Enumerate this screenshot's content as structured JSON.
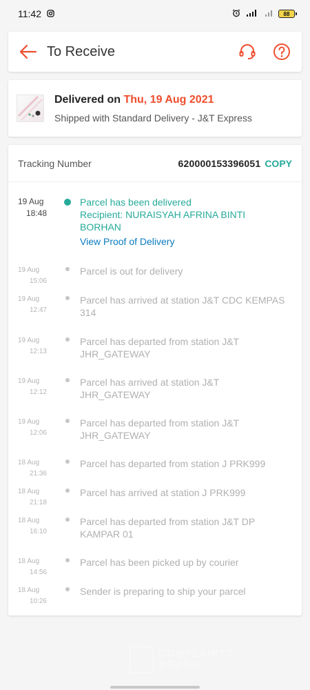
{
  "status_bar": {
    "time": "11:42",
    "battery": "88"
  },
  "header": {
    "title": "To Receive"
  },
  "delivery": {
    "delivered_prefix": "Delivered on",
    "delivered_date": "Thu, 19 Aug 2021",
    "shipped_text": "Shipped with Standard Delivery  - J&T Express"
  },
  "tracking": {
    "label": "Tracking Number",
    "number": "620000153396051",
    "copy_label": "COPY"
  },
  "events": [
    {
      "date": "19 Aug",
      "time": "18:48",
      "text": "Parcel has been delivered",
      "recipient": "Recipient: NURAISYAH AFRINA BINTI BORHAN",
      "link": "View Proof of Delivery"
    },
    {
      "date": "19 Aug",
      "time": "15:06",
      "text": "Parcel is out for delivery"
    },
    {
      "date": "19 Aug",
      "time": "12:47",
      "text": "Parcel has arrived at station J&T CDC KEMPAS 314"
    },
    {
      "date": "19 Aug",
      "time": "12:13",
      "text": "Parcel has departed from station J&T JHR_GATEWAY"
    },
    {
      "date": "19 Aug",
      "time": "12:12",
      "text": "Parcel has arrived at station J&T JHR_GATEWAY"
    },
    {
      "date": "19 Aug",
      "time": "12:06",
      "text": "Parcel has departed from station J&T JHR_GATEWAY"
    },
    {
      "date": "18 Aug",
      "time": "21:36",
      "text": "Parcel has departed from station J PRK999"
    },
    {
      "date": "18 Aug",
      "time": "21:18",
      "text": "Parcel has arrived at station J PRK999"
    },
    {
      "date": "18 Aug",
      "time": "16:10",
      "text": "Parcel has departed from station J&T DP KAMPAR 01"
    },
    {
      "date": "18 Aug",
      "time": "14:56",
      "text": "Parcel has been picked up by courier"
    },
    {
      "date": "18 Aug",
      "time": "10:26",
      "text": "Sender is preparing to ship your parcel"
    }
  ],
  "watermark": {
    "line1": "COMPLAINTS",
    "line2": "BOARD"
  },
  "colors": {
    "accent": "#ee4d2d",
    "teal": "#26aa99",
    "link": "#0a7bbf"
  }
}
